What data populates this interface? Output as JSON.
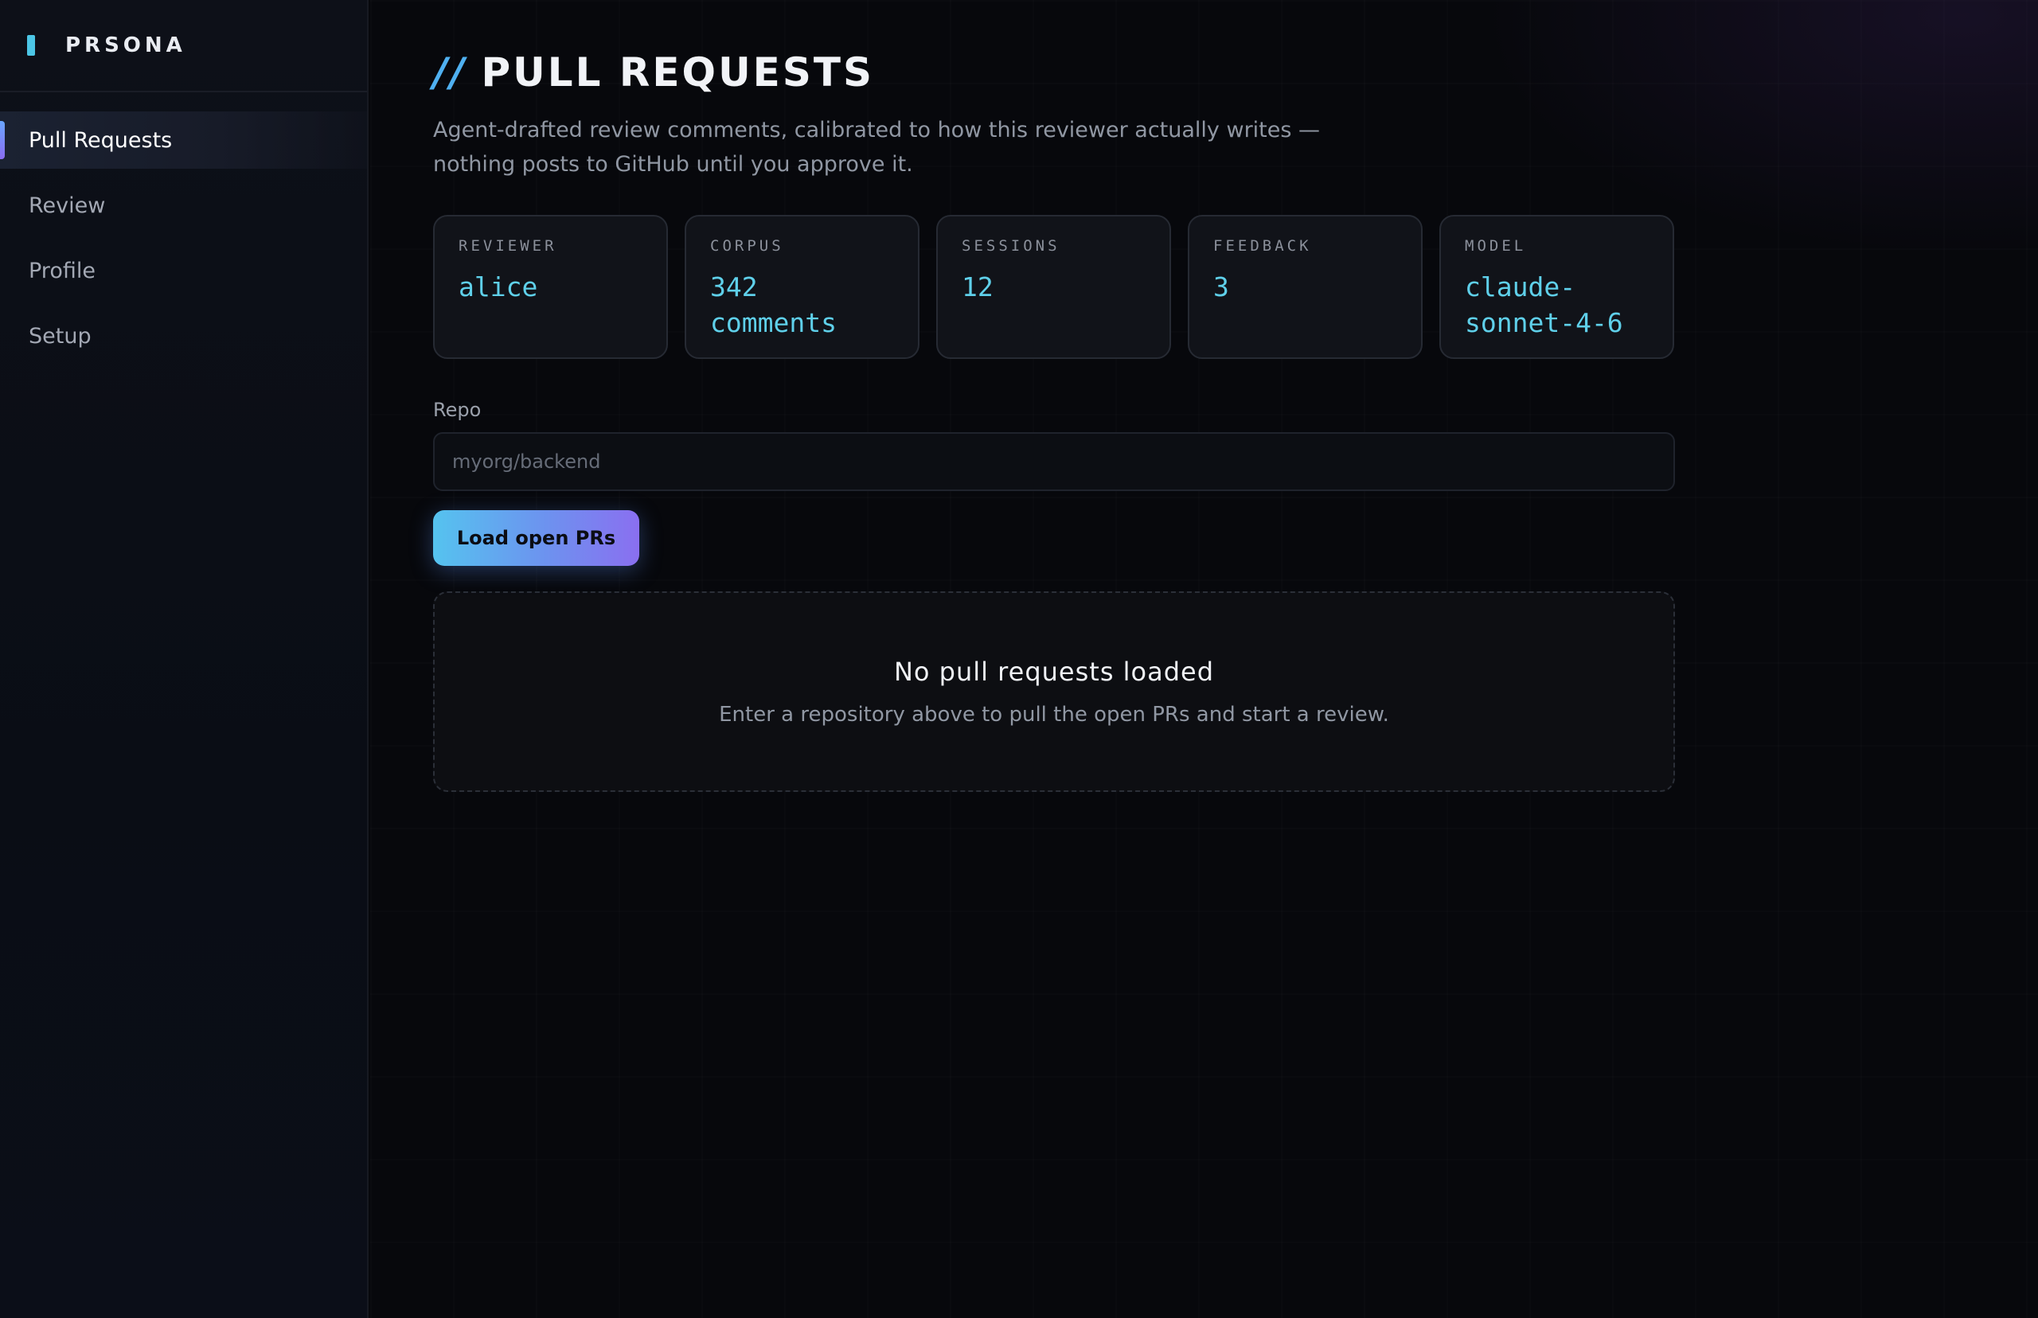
{
  "brand": {
    "name": "PRSONA"
  },
  "nav": {
    "items": [
      {
        "label": "Pull Requests",
        "active": true
      },
      {
        "label": "Review",
        "active": false
      },
      {
        "label": "Profile",
        "active": false
      },
      {
        "label": "Setup",
        "active": false
      }
    ]
  },
  "page": {
    "title_prefix": "//",
    "title": "PULL REQUESTS",
    "subtitle": "Agent-drafted review comments, calibrated to how this reviewer actually writes — nothing posts to GitHub until you approve it."
  },
  "stats": [
    {
      "label": "REVIEWER",
      "value": "alice"
    },
    {
      "label": "CORPUS",
      "value": "342 comments"
    },
    {
      "label": "SESSIONS",
      "value": "12"
    },
    {
      "label": "FEEDBACK",
      "value": "3"
    },
    {
      "label": "MODEL",
      "value": "claude-sonnet-4-6"
    }
  ],
  "repo": {
    "label": "Repo",
    "value": "",
    "placeholder": "myorg/backend"
  },
  "load_button": {
    "label": "Load open PRs"
  },
  "empty_state": {
    "title": "No pull requests loaded",
    "text": "Enter a repository above to pull the open PRs and start a review."
  },
  "colors": {
    "accent": "#5fd0ea",
    "button_gradient_start": "#55c3ef",
    "button_gradient_end": "#8a6ff0",
    "background": "#07080c"
  }
}
